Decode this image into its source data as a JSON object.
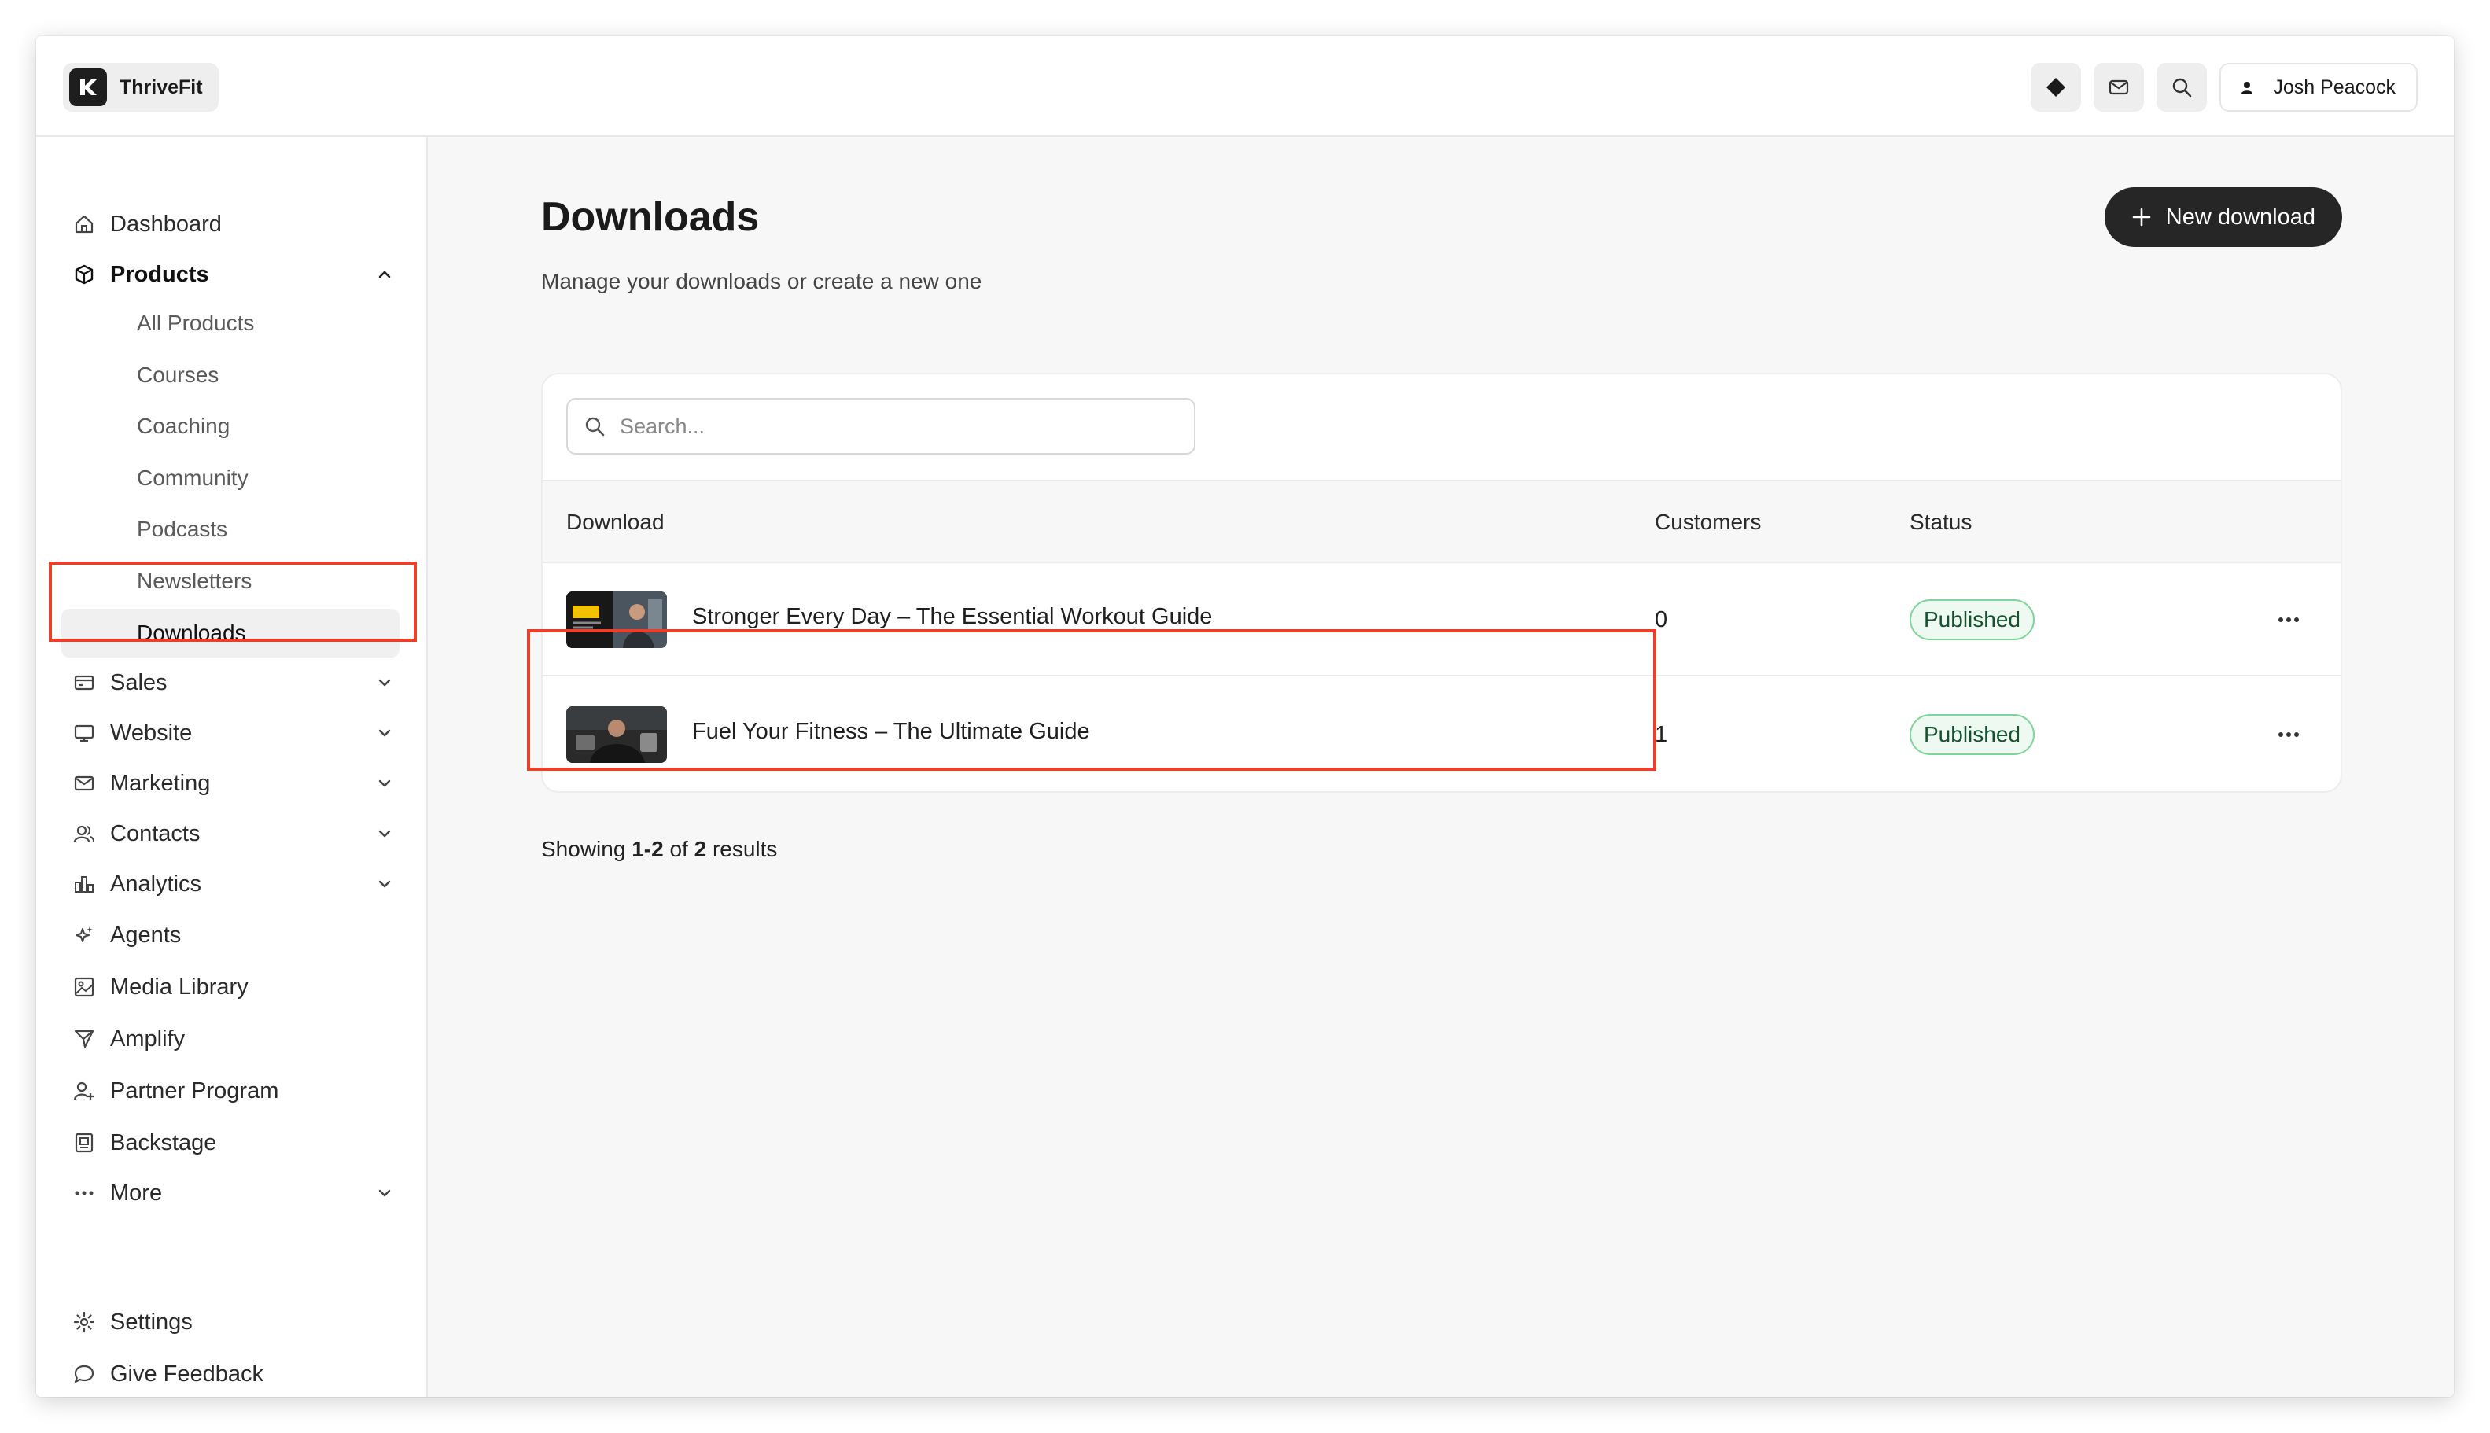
{
  "app": {
    "name": "ThriveFit"
  },
  "topbar": {
    "icons": [
      "diamond-icon",
      "mail-icon",
      "search-icon"
    ],
    "user_name": "Josh Peacock"
  },
  "sidebar": {
    "items": [
      {
        "label": "Dashboard",
        "icon": "home-icon"
      },
      {
        "label": "Products",
        "icon": "box-icon",
        "expanded": true
      },
      {
        "label": "Sales",
        "icon": "card-icon"
      },
      {
        "label": "Website",
        "icon": "monitor-icon"
      },
      {
        "label": "Marketing",
        "icon": "mail-icon"
      },
      {
        "label": "Contacts",
        "icon": "users-icon"
      },
      {
        "label": "Analytics",
        "icon": "chart-icon"
      },
      {
        "label": "Agents",
        "icon": "sparkle-icon"
      },
      {
        "label": "Media Library",
        "icon": "image-icon"
      },
      {
        "label": "Amplify",
        "icon": "send-icon"
      },
      {
        "label": "Partner Program",
        "icon": "partner-icon"
      },
      {
        "label": "Backstage",
        "icon": "backstage-icon"
      },
      {
        "label": "More",
        "icon": "dots-icon"
      }
    ],
    "products_sub": [
      "All Products",
      "Courses",
      "Coaching",
      "Community",
      "Podcasts",
      "Newsletters",
      "Downloads"
    ],
    "active_sub": "Downloads",
    "footer": [
      {
        "label": "Settings",
        "icon": "gear-icon"
      },
      {
        "label": "Give Feedback",
        "icon": "chat-icon"
      }
    ]
  },
  "main": {
    "title": "Downloads",
    "subtitle": "Manage your downloads or create a new one",
    "new_button": "New download",
    "search_placeholder": "Search...",
    "columns": {
      "download": "Download",
      "customers": "Customers",
      "status": "Status"
    },
    "rows": [
      {
        "title": "Stronger Every Day – The Essential Workout Guide",
        "customers": "0",
        "status": "Published"
      },
      {
        "title": "Fuel Your Fitness – The Ultimate Guide",
        "customers": "1",
        "status": "Published"
      }
    ],
    "results": {
      "prefix": "Showing",
      "range": "1-2",
      "of": "of",
      "total": "2",
      "suffix": "results"
    }
  },
  "colors": {
    "accent_dark": "#262626",
    "published_border": "#7ed59a",
    "annotation_red": "#e8402a"
  }
}
